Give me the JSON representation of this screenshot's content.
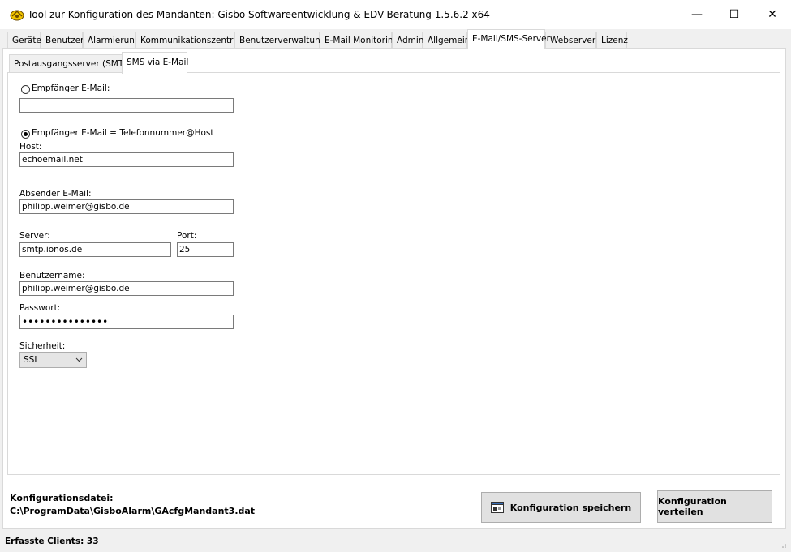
{
  "window": {
    "title": "Tool zur Konfiguration des Mandanten: Gisbo Softwareentwicklung & EDV-Beratung 1.5.6.2 x64",
    "minimize": "—",
    "maximize": "☐",
    "close": "✕"
  },
  "tabs": [
    "Geräte",
    "Benutzer",
    "Alarmierung",
    "Kommunikationszentrale",
    "Benutzerverwaltung",
    "E-Mail Monitoring",
    "Admin",
    "Allgemein",
    "E-Mail/SMS-Server",
    "Webserver",
    "Lizenz"
  ],
  "subtabs": [
    "Postausgangsserver (SMTP)",
    "SMS via E-Mail"
  ],
  "form": {
    "radio1_label": "Empfänger E-Mail:",
    "radio1_value": "",
    "radio2_label": "Empfänger E-Mail = Telefonnummer@Host",
    "host_label": "Host:",
    "host_value": "echoemail.net",
    "sender_label": "Absender E-Mail:",
    "sender_value": "philipp.weimer@gisbo.de",
    "server_label": "Server:",
    "server_value": "smtp.ionos.de",
    "port_label": "Port:",
    "port_value": "25",
    "username_label": "Benutzername:",
    "username_value": "philipp.weimer@gisbo.de",
    "password_label": "Passwort:",
    "password_value": "•••••••••••••••",
    "security_label": "Sicherheit:",
    "security_value": "SSL"
  },
  "footer": {
    "config_label": "Konfigurationsdatei:",
    "config_path": "C:\\ProgramData\\GisboAlarm\\GAcfgMandant3.dat",
    "save_button": "Konfiguration speichern",
    "distribute_button": "Konfiguration verteilen"
  },
  "status": {
    "clients": "Erfasste Clients: 33"
  }
}
